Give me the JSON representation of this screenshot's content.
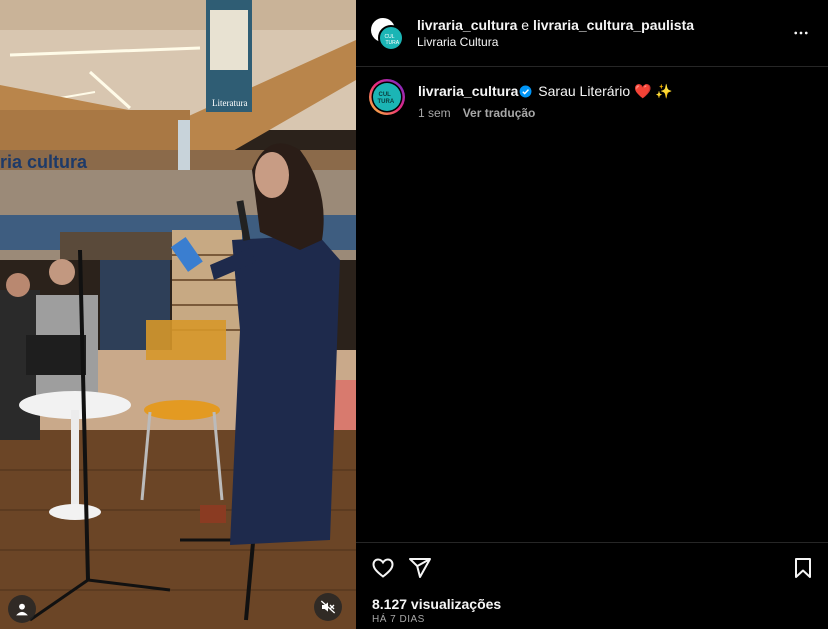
{
  "header": {
    "user1": "livraria_cultura",
    "joiner": "e",
    "user2": "livraria_cultura_paulista",
    "location": "Livraria Cultura"
  },
  "caption": {
    "username": "livraria_cultura",
    "text": "Sarau Literário",
    "emojis": "❤️ ✨",
    "time": "1 sem",
    "translate": "Ver tradução"
  },
  "stats": {
    "views": "8.127 visualizações",
    "posted": "HÁ 7 DIAS"
  },
  "scene": {
    "banner_top": "Literatura",
    "store_sign": "ria cultura"
  },
  "icons": {
    "more": "more-options-icon",
    "like": "heart-icon",
    "share": "share-icon",
    "save": "bookmark-icon",
    "tag": "tagged-user-icon",
    "mute": "muted-speaker-icon"
  },
  "colors": {
    "verified": "#0095f6",
    "brand_teal": "#1bb5b5",
    "story_ring_start": "#f9ce34",
    "story_ring_end": "#6228d7"
  }
}
